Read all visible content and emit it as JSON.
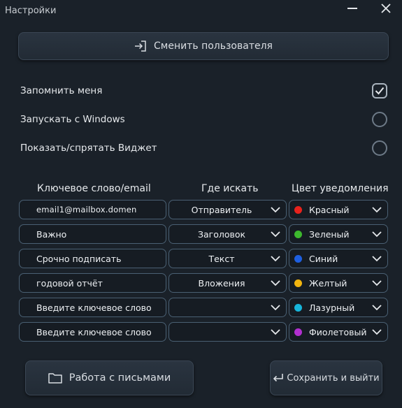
{
  "window": {
    "title": "Настройки"
  },
  "switch_user": {
    "label": "Сменить пользователя"
  },
  "options": [
    {
      "label": "Запомнить меня",
      "checked": true
    },
    {
      "label": "Запускать с Windows",
      "checked": false
    },
    {
      "label": "Показать/спрятать Виджет",
      "checked": false
    }
  ],
  "table": {
    "headers": {
      "keyword": "Ключевое слово/email",
      "where": "Где искать",
      "color": "Цвет уведомления"
    },
    "rows": [
      {
        "keyword": "email1@mailbox.domen",
        "where": "Отправитель",
        "color": "Красный",
        "color_hex": "#e8221c"
      },
      {
        "keyword": "Важно",
        "where": "Заголовок",
        "color": "Зеленый",
        "color_hex": "#3db82e"
      },
      {
        "keyword": "Срочно подписать",
        "where": "Текст",
        "color": "Синий",
        "color_hex": "#1e5fe0"
      },
      {
        "keyword": "годовой отчёт",
        "where": "Вложения",
        "color": "Желтый",
        "color_hex": "#f2b50f"
      },
      {
        "keyword": "Введите ключевое слово",
        "where": "",
        "color": "Лазурный",
        "color_hex": "#17b5da"
      },
      {
        "keyword": "Введите ключевое слово",
        "where": "",
        "color": "Фиолетовый",
        "color_hex": "#b22fd0"
      }
    ]
  },
  "buttons": {
    "mail": "Работа с письмами",
    "save": "Сохранить и выйти"
  },
  "icons": {
    "switch_user": "sign-in-icon",
    "mail": "folder-icon",
    "save": "enter-arrow-icon",
    "close": "close-icon",
    "minimize": "minimize-icon",
    "dropdown": "chevron-down-icon",
    "check": "check-icon"
  }
}
